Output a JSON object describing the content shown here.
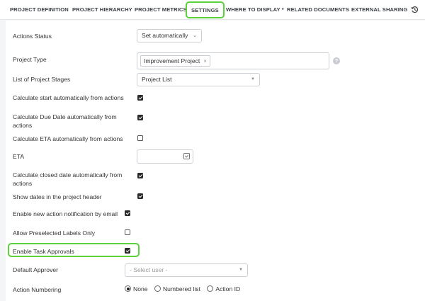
{
  "tabs": [
    {
      "label": "PROJECT DEFINITION"
    },
    {
      "label": "PROJECT HIERARCHY"
    },
    {
      "label": "PROJECT METRICS"
    },
    {
      "label": "SETTINGS",
      "active": true
    },
    {
      "label": "WHERE TO DISPLAY *"
    },
    {
      "label": "RELATED DOCUMENTS"
    },
    {
      "label": "EXTERNAL SHARING"
    }
  ],
  "icons": {
    "history": "history-icon",
    "help": "help-icon",
    "calendar": "calendar-icon",
    "remove_tag": "close-icon",
    "dropdown": "chevron-down-icon"
  },
  "colors": {
    "highlight": "#5bd23a",
    "checkbox": "#2a2a2a"
  },
  "settings": {
    "actions_status": {
      "label": "Actions Status",
      "value": "Set automatically"
    },
    "project_type": {
      "label": "Project Type",
      "tag": "Improvement Project",
      "remove": "×",
      "help": "?"
    },
    "project_stages": {
      "label": "List of Project Stages",
      "value": "Project List"
    },
    "calc_start": {
      "label": "Calculate start automatically from actions",
      "checked": true
    },
    "calc_due": {
      "label": "Calculate Due Date automatically from actions",
      "checked": true
    },
    "calc_eta": {
      "label": "Calculate ETA automatically from actions",
      "checked": false
    },
    "eta": {
      "label": "ETA",
      "value": ""
    },
    "calc_closed": {
      "label": "Calculate closed date automatically from actions",
      "checked": true
    },
    "show_dates": {
      "label": "Show dates in the project header",
      "checked": true
    },
    "new_action_notification": {
      "label": "Enable new action notification by email",
      "checked": true
    },
    "preselected_labels": {
      "label": "Allow Preselected Labels Only",
      "checked": false
    },
    "task_approvals": {
      "label": "Enable Task Approvals",
      "checked": true
    },
    "default_approver": {
      "label": "Default Approver",
      "placeholder": "- Select user -"
    },
    "action_numbering": {
      "label": "Action Numbering",
      "options": [
        "None",
        "Numbered list",
        "Action ID"
      ],
      "selected": "None"
    }
  }
}
